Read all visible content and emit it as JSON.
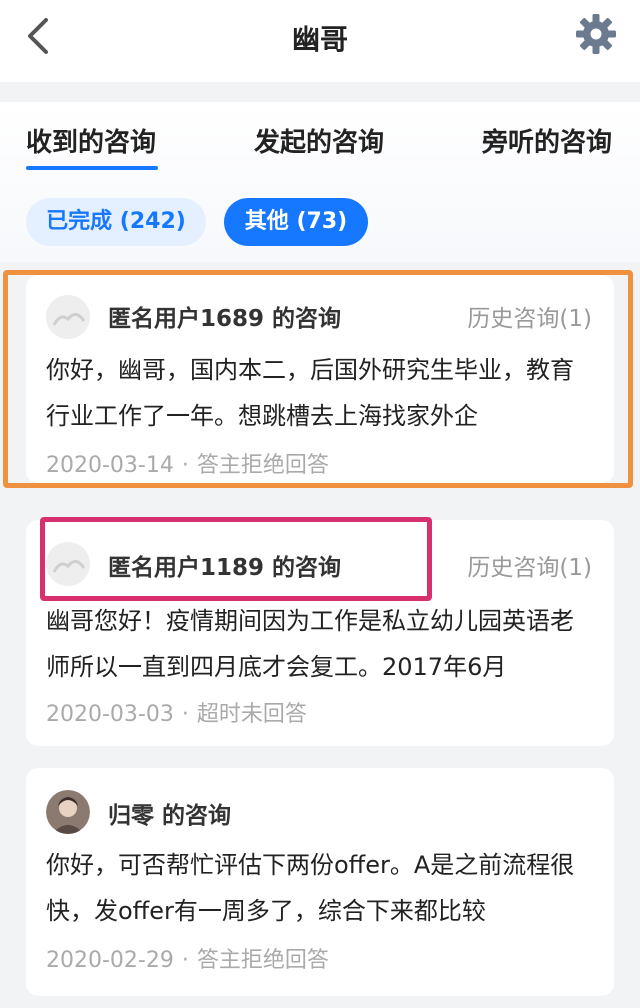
{
  "header": {
    "title": "幽哥",
    "back_icon": "chevron-left-icon",
    "settings_icon": "gear-icon"
  },
  "tabs": [
    {
      "label": "收到的咨询",
      "active": true
    },
    {
      "label": "发起的咨询",
      "active": false
    },
    {
      "label": "旁听的咨询",
      "active": false
    }
  ],
  "filters": [
    {
      "label": "已完成 (242)",
      "active": false
    },
    {
      "label": "其他 (73)",
      "active": true
    }
  ],
  "consults": [
    {
      "name": "匿名用户1689 的咨询",
      "history": "历史咨询(1)",
      "text": "你好，幽哥，国内本二，后国外研究生毕业，教育行业工作了一年。想跳槽去上海找家外企",
      "date": "2020-03-14",
      "status": "答主拒绝回答"
    },
    {
      "name": "匿名用户1189 的咨询",
      "history": "历史咨询(1)",
      "text": "幽哥您好！疫情期间因为工作是私立幼儿园英语老师所以一直到四月底才会复工。2017年6月",
      "date": "2020-03-03",
      "status": "超时未回答"
    },
    {
      "name": "归零 的咨询",
      "history": "",
      "text": "你好，可否帮忙评估下两份offer。A是之前流程很快，发offer有一周多了，综合下来都比较",
      "date": "2020-02-29",
      "status": "答主拒绝回答"
    }
  ],
  "separator": "·",
  "colors": {
    "accent": "#1677ff",
    "highlight_orange": "#f0913f",
    "highlight_pink": "#d8306e"
  }
}
